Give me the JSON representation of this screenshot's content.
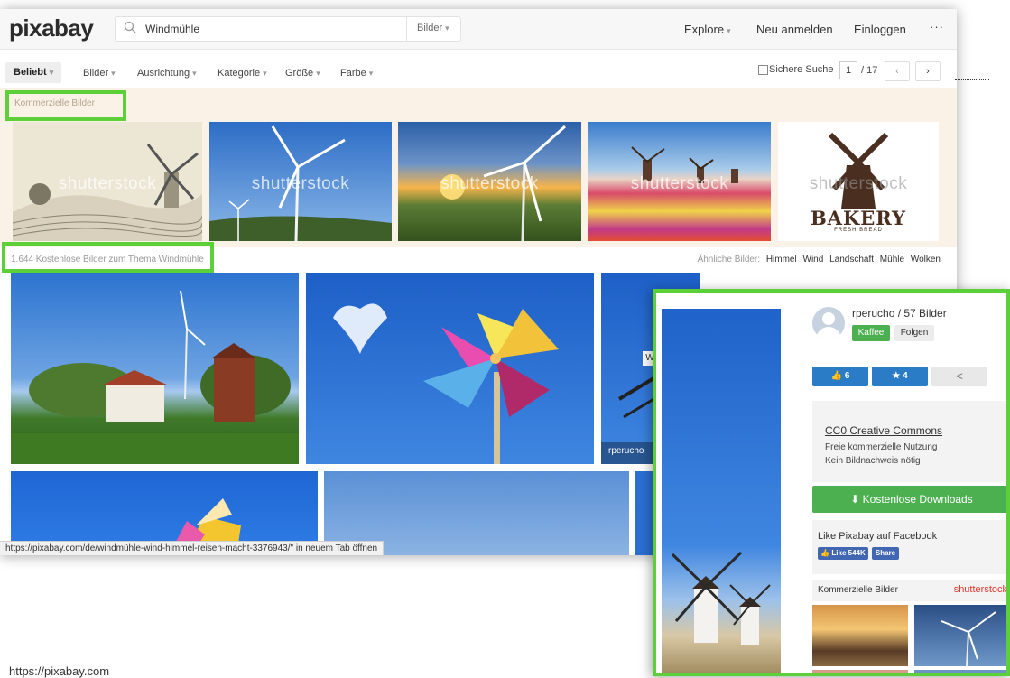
{
  "header": {
    "logo": "pixabay",
    "search_value": "Windmühle",
    "search_type": "Bilder",
    "nav": {
      "explore": "Explore",
      "signup": "Neu anmelden",
      "login": "Einloggen",
      "more": "···"
    }
  },
  "filters": {
    "items": [
      "Beliebt",
      "Bilder",
      "Ausrichtung",
      "Kategorie",
      "Größe",
      "Farbe"
    ],
    "safe_search": "Sichere Suche",
    "page_current": "1",
    "page_total": "/ 17",
    "prev": "‹",
    "next": "›"
  },
  "commercial": {
    "label": "Kommerzielle Bilder",
    "watermark": "shutterstock",
    "bakery_title": "BAKERY",
    "bakery_sub": "FRESH BREAD"
  },
  "free": {
    "count_label": "1.644 Kostenlose Bilder zum Thema Windmühle",
    "related_label": "Ähnliche Bilder:",
    "related": [
      "Himmel",
      "Wind",
      "Landschaft",
      "Mühle",
      "Wolken"
    ]
  },
  "grid": {
    "photo_user": "rperucho",
    "hover_letter": "W"
  },
  "status_bar": "https://pixabay.com/de/windmühle-wind-himmel-reisen-macht-3376943/\" in neuem Tab öffnen",
  "popup": {
    "user": "rperucho / 57 Bilder",
    "coffee": "Kaffee",
    "follow": "Folgen",
    "likes": "6",
    "favorites": "4",
    "license_title": "CC0 Creative Commons",
    "license_line1": "Freie kommerzielle Nutzung",
    "license_line2": "Kein Bildnachweis nötig",
    "download": "Kostenlose Downloads",
    "facebook_label": "Like Pixabay auf Facebook",
    "fb_like": "Like",
    "fb_count": "544K",
    "fb_share": "Share",
    "commercial_label": "Kommerzielle Bilder",
    "shutterstock": "shutterstock"
  },
  "footer_url": "https://pixabay.com",
  "colors": {
    "accent_green": "#5cd038",
    "pixabay_green": "#4caf50",
    "like_blue": "#2a7cc7",
    "fb_blue": "#4267b2"
  }
}
